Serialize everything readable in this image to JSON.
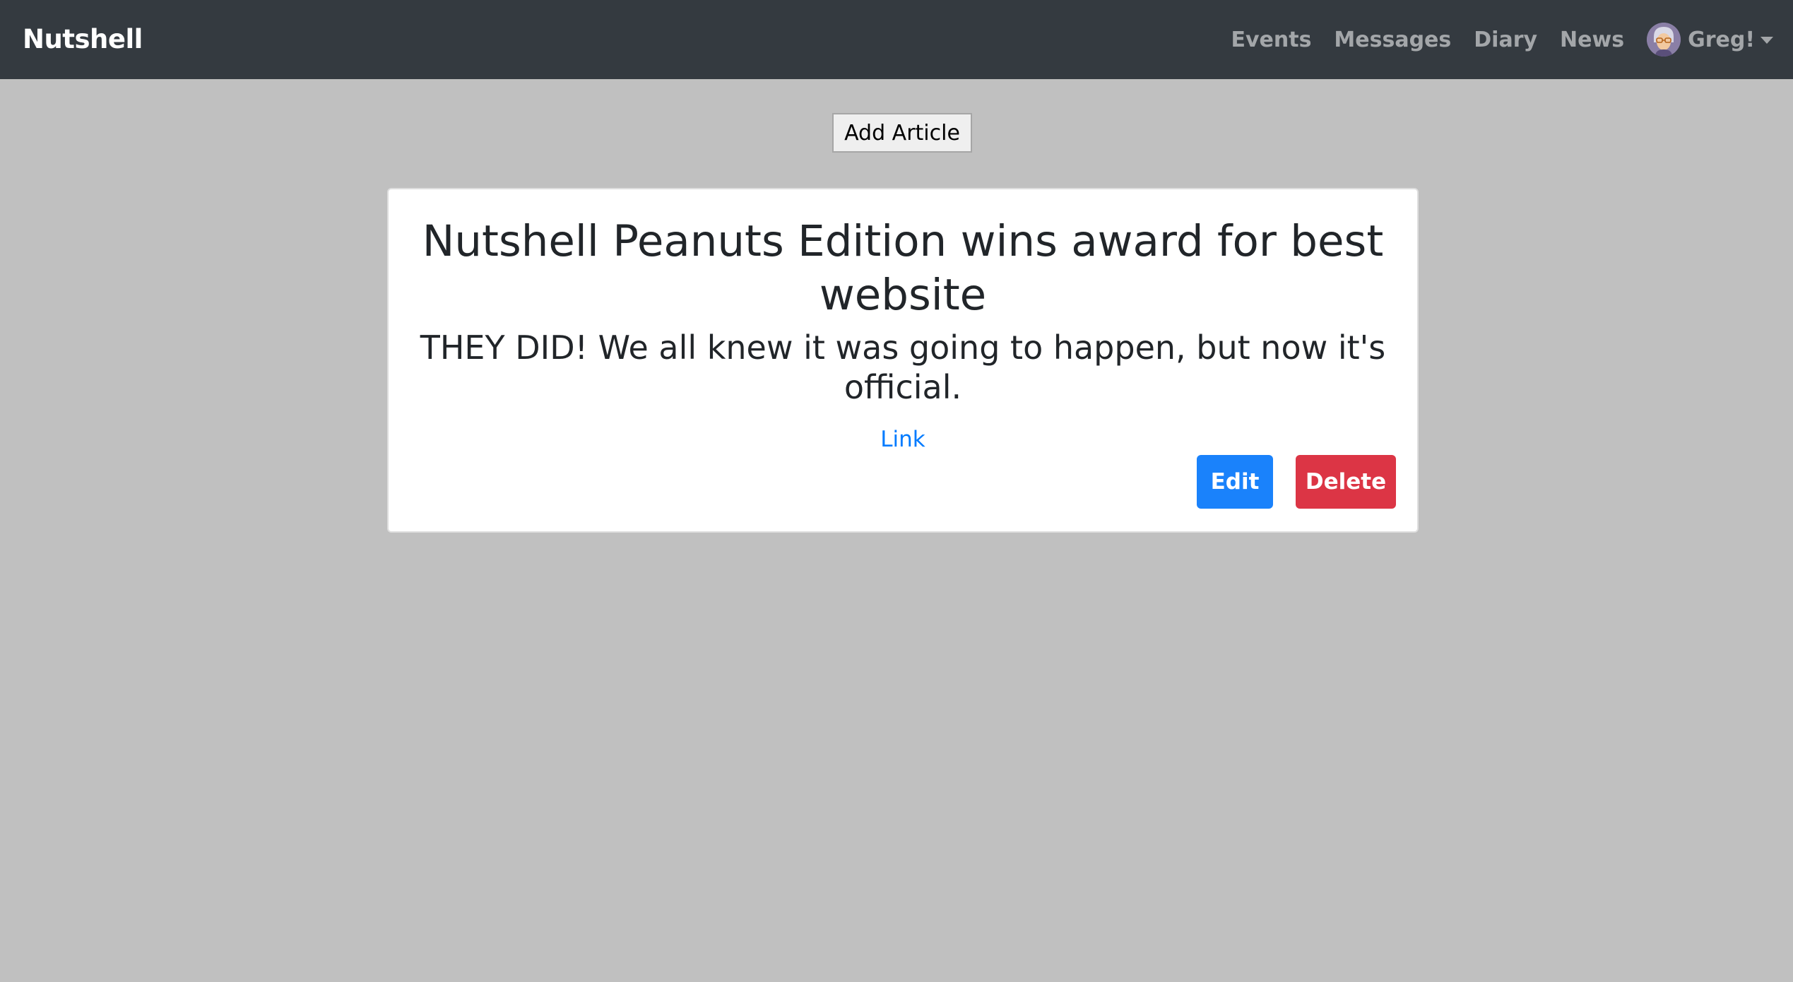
{
  "navbar": {
    "brand": "Nutshell",
    "links": [
      "Events",
      "Messages",
      "Diary",
      "News"
    ],
    "user": {
      "name": "Greg!"
    },
    "background": "#343a40"
  },
  "main": {
    "add_button_label": "Add Article",
    "article": {
      "title": "Nutshell Peanuts Edition wins award for best website",
      "synopsis": "THEY DID! We all knew it was going to happen, but now it's official.",
      "link_label": "Link",
      "edit_label": "Edit",
      "delete_label": "Delete"
    }
  },
  "colors": {
    "page_background": "#c0c0c0",
    "primary": "#1a82fb",
    "danger": "#dc3545",
    "link": "#007bff"
  },
  "icons": {
    "avatar": "user-avatar-icon",
    "dropdown": "caret-down-icon"
  }
}
